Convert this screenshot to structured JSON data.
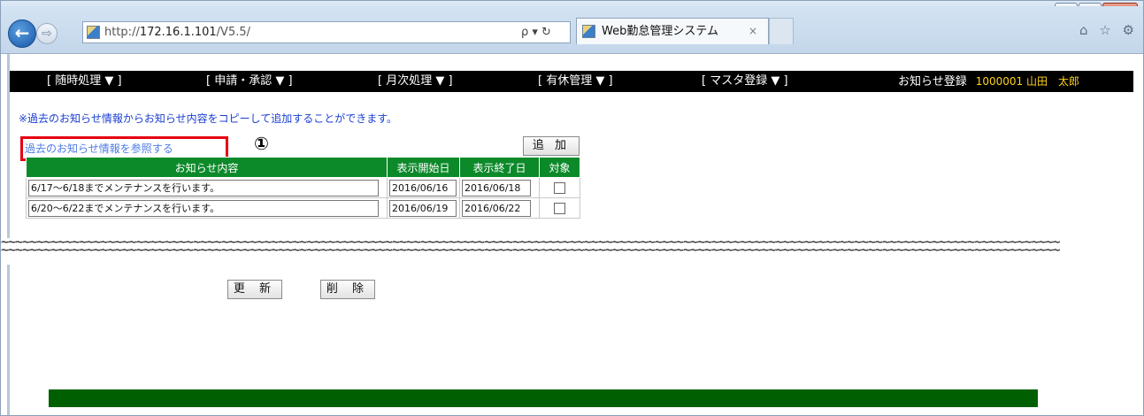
{
  "browser": {
    "url_protocol": "http://",
    "url_host": "172.16.1.101",
    "url_path": "/V5.5/",
    "addr_icons": "ρ ▾ ↻",
    "tab_title": "Web勤怠管理システム",
    "tab_close": "×",
    "back_glyph": "←",
    "forward_glyph": "⇨",
    "toolbar_icons": "⌂ ☆ ⚙",
    "window_buttons": [
      "▬",
      "▫",
      "✕"
    ]
  },
  "menubar": {
    "items": [
      "[ 随時処理 ▼ ]",
      "[ 申請・承認 ▼ ]",
      "[ 月次処理 ▼ ]",
      "[ 有休管理 ▼ ]",
      "[ マスタ登録 ▼ ]"
    ],
    "page_name": "お知らせ登録",
    "user": "1000001 山田　太郎"
  },
  "content": {
    "notice": "※過去のお知らせ情報からお知らせ内容をコピーして追加することができます。",
    "reference_link": "過去のお知らせ情報を参照する",
    "annotation_number": "①",
    "add_button": "追 加",
    "table": {
      "headers": [
        "お知らせ内容",
        "表示開始日",
        "表示終了日",
        "対象"
      ],
      "rows": [
        {
          "content": "6/17～6/18までメンテナンスを行います。",
          "start": "2016/06/16",
          "end": "2016/06/18",
          "checked": false
        },
        {
          "content": "6/20～6/22までメンテナンスを行います。",
          "start": "2016/06/19",
          "end": "2016/06/22",
          "checked": false
        }
      ]
    }
  },
  "separator": "~~~~~~~~~~~~~~~~~~~~~~~~~~~~~~~~~~~~~~~~~~~~~~~~~~~~~~~~~~~~~~~~~~~~~~~~~~~~~~~~~~~~~~~~~~~~~~~~~~~~~~~~~~~~~~~~~~~~~~~~~~~~~~~~~~~~~~~~~~~~~~~~~~~~~",
  "actions": {
    "update_button": "更 新",
    "delete_button": "削 除"
  },
  "colors": {
    "menu_bg": "#000000",
    "header_green": "#0c8a2a",
    "footer_green": "#005f00",
    "highlight_red": "#e60012",
    "notice_blue": "#1a3fd0",
    "user_yellow": "#ffd21a"
  }
}
